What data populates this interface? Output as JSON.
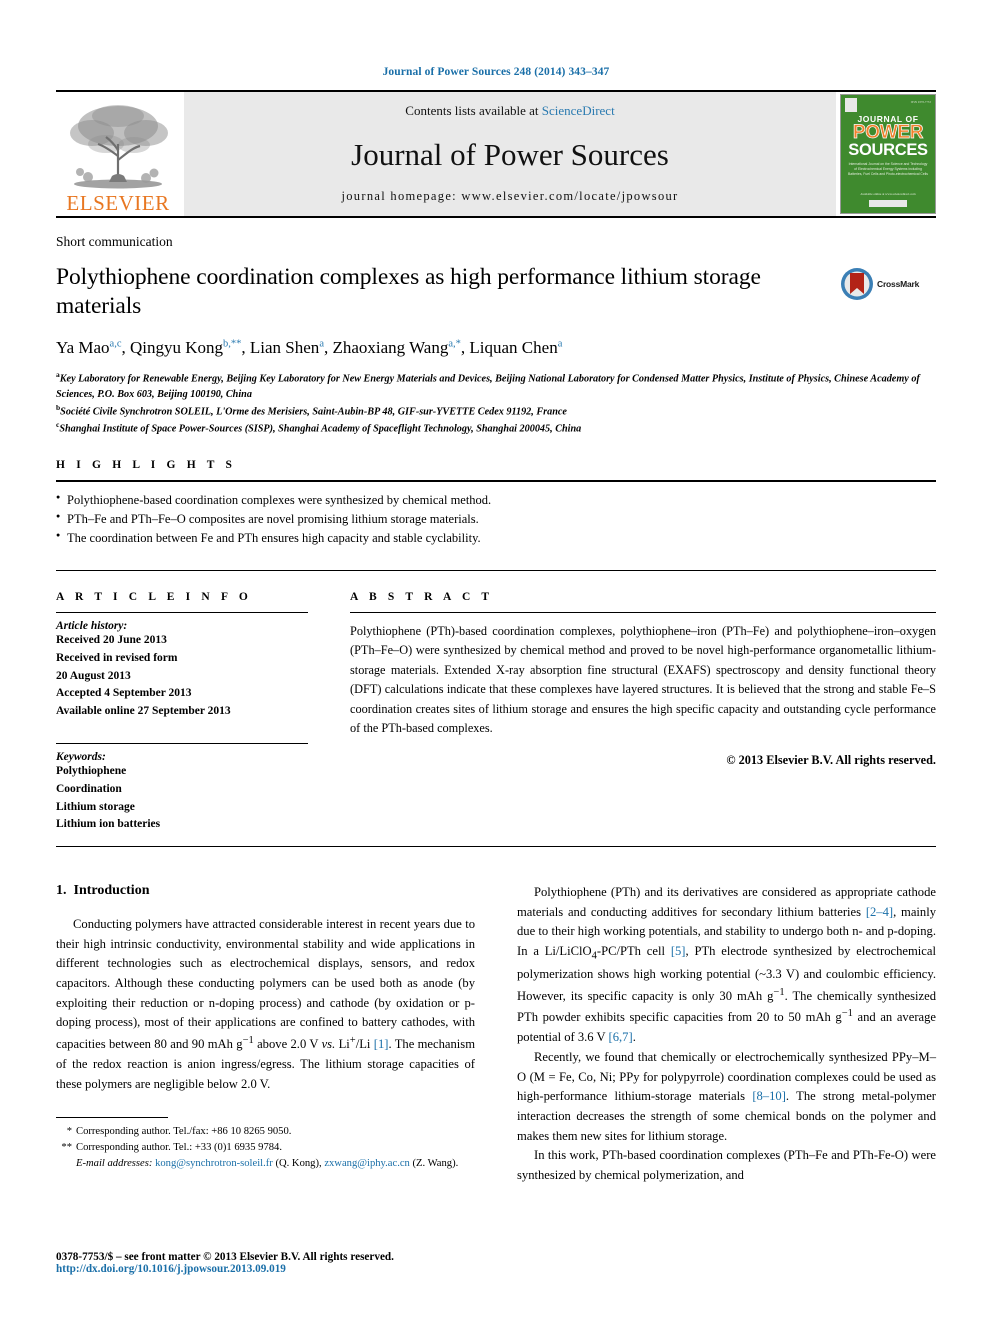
{
  "running_head": "Journal of Power Sources 248 (2014) 343–347",
  "masthead": {
    "publisher_name": "ELSEVIER",
    "contents_prefix": "Contents lists available at ",
    "contents_link": "ScienceDirect",
    "journal_title": "Journal of Power Sources",
    "homepage": "journal homepage: www.elsevier.com/locate/jpowsour",
    "cover": {
      "line1": "JOURNAL OF",
      "line2": "POWER",
      "line3": "SOURCES",
      "subtitle": "International Journal on the Science and Technology of Electrochemical Energy Systems including Batteries, Fuel Cells and Photo-electrochemical Cells",
      "footer": "Available online at www.sciencedirect.com"
    }
  },
  "article": {
    "type": "Short communication",
    "title": "Polythiophene coordination complexes as high performance lithium storage materials",
    "crossmark_label": "CrossMark",
    "authors": [
      {
        "name": "Ya Mao",
        "sup": "a,c",
        "sep": ", "
      },
      {
        "name": "Qingyu Kong",
        "sup": "b,**",
        "sep": ", "
      },
      {
        "name": "Lian Shen",
        "sup": "a",
        "sep": ", "
      },
      {
        "name": "Zhaoxiang Wang",
        "sup": "a,*",
        "sep": ", "
      },
      {
        "name": "Liquan Chen",
        "sup": "a",
        "sep": ""
      }
    ],
    "affiliations": [
      {
        "mark": "a",
        "text": "Key Laboratory for Renewable Energy, Beijing Key Laboratory for New Energy Materials and Devices, Beijing National Laboratory for Condensed Matter Physics, Institute of Physics, Chinese Academy of Sciences, P.O. Box 603, Beijing 100190, China"
      },
      {
        "mark": "b",
        "text": "Société Civile Synchrotron SOLEIL, L'Orme des Merisiers, Saint-Aubin-BP 48, GIF-sur-YVETTE Cedex 91192, France"
      },
      {
        "mark": "c",
        "text": "Shanghai Institute of Space Power-Sources (SISP), Shanghai Academy of Spaceflight Technology, Shanghai 200045, China"
      }
    ]
  },
  "highlights": {
    "heading": "H I G H L I G H T S",
    "items": [
      "Polythiophene-based coordination complexes were synthesized by chemical method.",
      "PTh–Fe and PTh–Fe–O composites are novel promising lithium storage materials.",
      "The coordination between Fe and PTh ensures high capacity and stable cyclability."
    ]
  },
  "article_info": {
    "heading": "A R T I C L E  I N F O",
    "history_label": "Article history:",
    "history": [
      "Received 20 June 2013",
      "Received in revised form",
      "20 August 2013",
      "Accepted 4 September 2013",
      "Available online 27 September 2013"
    ],
    "keywords_label": "Keywords:",
    "keywords": [
      "Polythiophene",
      "Coordination",
      "Lithium storage",
      "Lithium ion batteries"
    ]
  },
  "abstract": {
    "heading": "A B S T R A C T",
    "text": "Polythiophene (PTh)-based coordination complexes, polythiophene–iron (PTh–Fe) and polythiophene–iron–oxygen (PTh–Fe–O) were synthesized by chemical method and proved to be novel high-performance organometallic lithium-storage materials. Extended X-ray absorption fine structural (EXAFS) spectroscopy and density functional theory (DFT) calculations indicate that these complexes have layered structures. It is believed that the strong and stable Fe–S coordination creates sites of lithium storage and ensures the high specific capacity and outstanding cycle performance of the PTh-based complexes.",
    "copyright": "© 2013 Elsevier B.V. All rights reserved."
  },
  "body": {
    "section_number": "1.",
    "section_title": "Introduction",
    "left_paragraphs": [
      "Conducting polymers have attracted considerable interest in recent years due to their high intrinsic conductivity, environmental stability and wide applications in different technologies such as electrochemical displays, sensors, and redox capacitors. Although these conducting polymers can be used both as anode (by exploiting their reduction or n-doping process) and cathode (by oxidation or p-doping process), most of their applications are confined to battery cathodes, with capacities between 80 and 90 mAh g−1 above 2.0 V vs. Li+/Li [1]. The mechanism of the redox reaction is anion ingress/egress. The lithium storage capacities of these polymers are negligible below 2.0 V."
    ],
    "right_paragraphs": [
      "Polythiophene (PTh) and its derivatives are considered as appropriate cathode materials and conducting additives for secondary lithium batteries [2–4], mainly due to their high working potentials, and stability to undergo both n- and p-doping. In a Li/LiClO4-PC/PTh cell [5], PTh electrode synthesized by electrochemical polymerization shows high working potential (~3.3 V) and coulombic efficiency. However, its specific capacity is only 30 mAh g−1. The chemically synthesized PTh powder exhibits specific capacities from 20 to 50 mAh g−1 and an average potential of 3.6 V [6,7].",
      "Recently, we found that chemically or electrochemically synthesized PPy–M–O (M = Fe, Co, Ni; PPy for polypyrrole) coordination complexes could be used as high-performance lithium-storage materials [8–10]. The strong metal-polymer interaction decreases the strength of some chemical bonds on the polymer and makes them new sites for lithium storage.",
      "In this work, PTh-based coordination complexes (PTh–Fe and PTh-Fe-O) were synthesized by chemical polymerization, and"
    ]
  },
  "footnotes": {
    "corresponding_1": "Corresponding author. Tel./fax: +86 10 8265 9050.",
    "corresponding_1_mark": "*",
    "corresponding_2": "Corresponding author. Tel.: +33 (0)1 6935 9784.",
    "corresponding_2_mark": "**",
    "email_label": "E-mail addresses:",
    "email_1": "kong@synchrotron-soleil.fr",
    "email_1_owner": "(Q. Kong),",
    "email_2": "zxwang@iphy.ac.cn",
    "email_2_owner": "(Z. Wang)."
  },
  "page_footer": {
    "issn": "0378-7753/$ – see front matter © 2013 Elsevier B.V. All rights reserved.",
    "doi": "http://dx.doi.org/10.1016/j.jpowsour.2013.09.019"
  },
  "colors": {
    "link": "#1a6fa8",
    "elsevier_orange": "#e87722",
    "cover_green": "#3f8a2e",
    "banner_gray": "#e9e9e9"
  }
}
